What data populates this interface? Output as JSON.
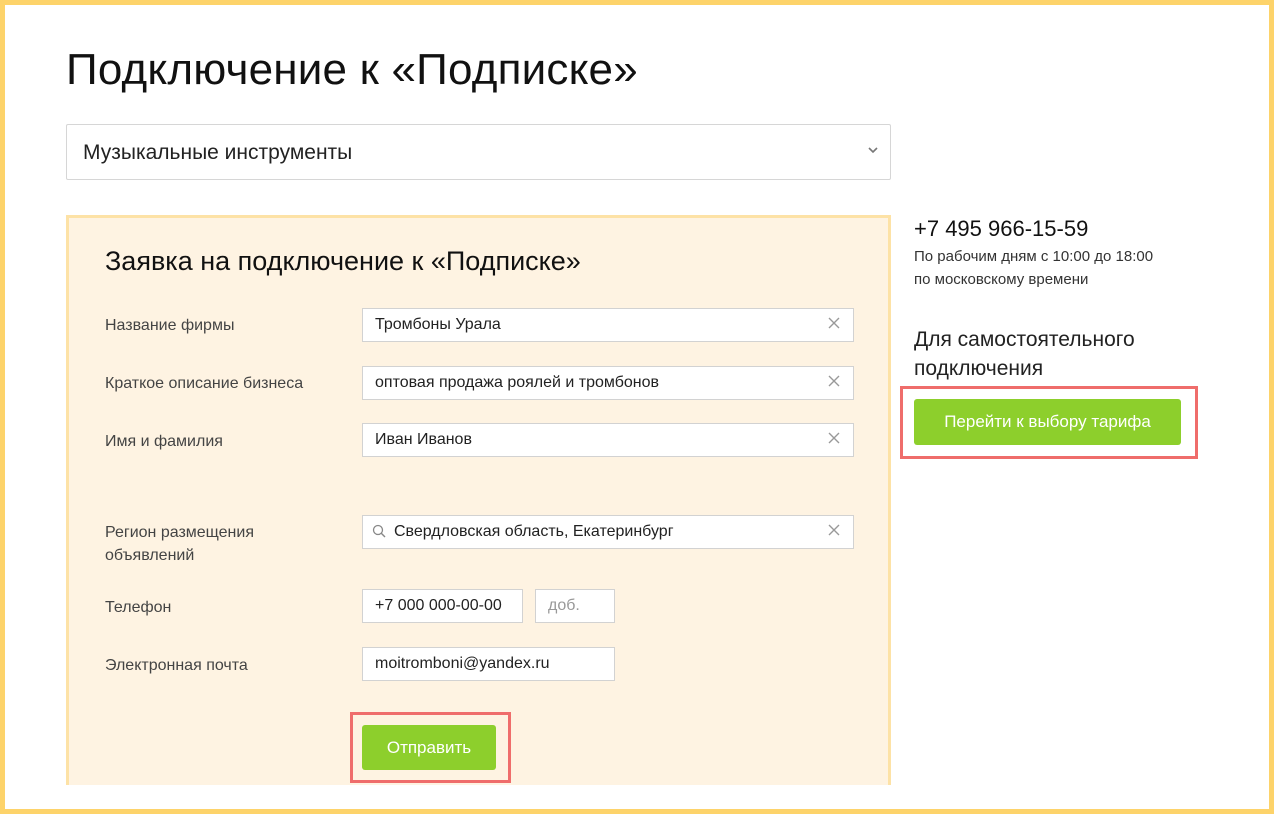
{
  "page": {
    "title": "Подключение к «Подписке»"
  },
  "category_select": {
    "value": "Музыкальные инструменты",
    "chevron": "chevron-down-icon"
  },
  "form": {
    "title": "Заявка на подключение к «Подписке»",
    "fields": {
      "company": {
        "label": "Название фирмы",
        "value": "Тромбоны Урала"
      },
      "description": {
        "label": "Краткое описание бизнеса",
        "value": "оптовая продажа роялей и тромбонов"
      },
      "name": {
        "label": "Имя и фамилия",
        "value": "Иван Иванов"
      },
      "region": {
        "label_line1": "Регион размещения",
        "label_line2": "объявлений",
        "value": "Свердловская область, Екатеринбург"
      },
      "phone": {
        "label": "Телефон",
        "value": "+7 000 000-00-00",
        "ext_placeholder": "доб."
      },
      "email": {
        "label": "Электронная почта",
        "value": "moitromboni@yandex.ru"
      }
    },
    "submit_label": "Отправить"
  },
  "sidebar": {
    "phone": "+7 495 966-15-59",
    "hours_line1": "По рабочим дням с 10:00 до 18:00",
    "hours_line2": "по московскому времени",
    "self_connect_line1": "Для самостоятельного",
    "self_connect_line2": "подключения",
    "tariff_button_label": "Перейти к выбору тарифа"
  },
  "colors": {
    "frame_border": "#fdd36a",
    "form_background": "#fef3e2",
    "button_green": "#8dcf2c",
    "highlight_red": "#ef6d6b"
  }
}
